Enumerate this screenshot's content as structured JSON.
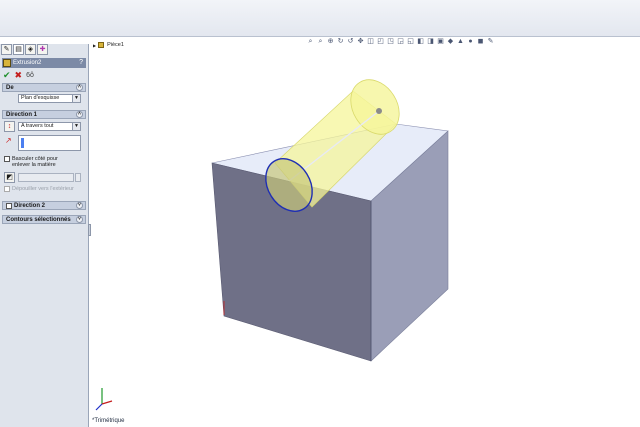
{
  "panel": {
    "feature_name": "Extrusion2",
    "help": "?",
    "from_group": {
      "title": "De",
      "start_condition": "Plan d'esquisse"
    },
    "direction1": {
      "title": "Direction 1",
      "end_condition": "A travers tout",
      "flip_label": "Basculer côté pour enlever la matière",
      "draft_outward_label": "Dépouiller vers l'extérieur"
    },
    "direction2": {
      "title": "Direction 2"
    },
    "contours": {
      "title": "Contours sélectionnés"
    }
  },
  "tree": {
    "part_name": "Pièce1"
  },
  "view": {
    "orientation": "*Trimétrique"
  },
  "view_toolbar": {
    "icons": [
      "zoom-to-fit-icon",
      "zoom-area-icon",
      "zoom-in-out-icon",
      "rotate-icon",
      "roll-icon",
      "pan-icon",
      "previous-view-icon",
      "front-view-icon",
      "top-view-icon",
      "right-view-icon",
      "isometric-view-icon",
      "normal-to-icon",
      "section-view-icon",
      "view-orientation-icon",
      "display-style-icon",
      "hide-show-icon",
      "edit-appearance-icon",
      "apply-scene-icon",
      "view-settings-icon"
    ]
  },
  "colors": {
    "face_top": "#e7ecf9",
    "face_front": "#6f7087",
    "face_right": "#9a9eb7",
    "preview_yellow": "#f5f59a",
    "sketch_blue": "#1f2fb4"
  }
}
